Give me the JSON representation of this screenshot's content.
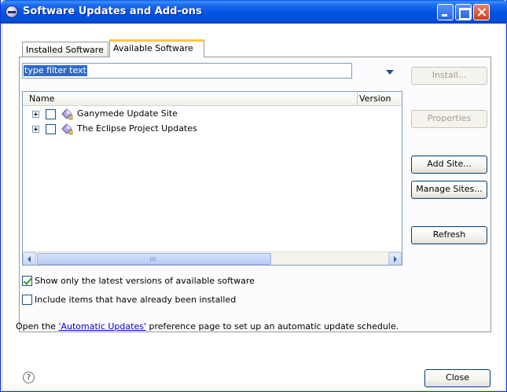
{
  "window": {
    "title": "Software Updates and Add-ons"
  },
  "tabs": [
    {
      "label": "Installed Software",
      "selected": false
    },
    {
      "label": "Available Software",
      "selected": true
    }
  ],
  "filter": {
    "value": "type filter text"
  },
  "tree": {
    "columns": [
      "Name",
      "Version"
    ],
    "rows": [
      {
        "label": "Ganymede Update Site",
        "checked": false,
        "icon": "update-site-icon"
      },
      {
        "label": "The Eclipse Project Updates",
        "checked": false,
        "icon": "update-site-icon"
      }
    ]
  },
  "buttons": {
    "install": "Install...",
    "properties": "Properties",
    "add_site": "Add Site...",
    "manage_sites": "Manage Sites...",
    "refresh": "Refresh",
    "close": "Close"
  },
  "options": [
    {
      "label": "Show only the latest versions of available software",
      "checked": true
    },
    {
      "label": "Include items that have already been installed",
      "checked": false
    }
  ],
  "info": {
    "prefix": "Open the ",
    "link": "'Automatic Updates'",
    "suffix": " preference page to set up an automatic update schedule."
  },
  "help": {
    "glyph": "?"
  },
  "colors": {
    "title_bar": "#0054e3",
    "tab_highlight": "#ffc83c",
    "selection": "#316ac5",
    "link": "#0000cc"
  }
}
